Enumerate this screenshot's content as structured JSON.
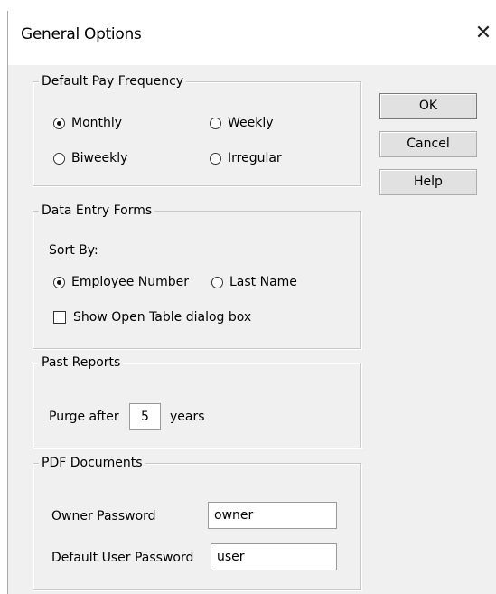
{
  "dialog": {
    "title": "General Options",
    "close_glyph": "✕"
  },
  "pay_frequency": {
    "legend": "Default Pay Frequency",
    "options": [
      {
        "label": "Monthly",
        "selected": true
      },
      {
        "label": "Weekly",
        "selected": false
      },
      {
        "label": "Biweekly",
        "selected": false
      },
      {
        "label": "Irregular",
        "selected": false
      }
    ]
  },
  "data_entry": {
    "legend": "Data Entry Forms",
    "sort_by_label": "Sort By:",
    "options": [
      {
        "label": "Employee Number",
        "selected": true
      },
      {
        "label": "Last Name",
        "selected": false
      }
    ],
    "checkbox": {
      "label": "Show Open Table dialog box",
      "checked": false
    }
  },
  "past_reports": {
    "legend": "Past Reports",
    "prefix": "Purge after",
    "value": "5",
    "suffix": "years"
  },
  "pdf_documents": {
    "legend": "PDF Documents",
    "owner_label": "Owner Password",
    "owner_value": "owner",
    "user_label": "Default User Password",
    "user_value": "user"
  },
  "buttons": {
    "ok": "OK",
    "cancel": "Cancel",
    "help": "Help"
  }
}
